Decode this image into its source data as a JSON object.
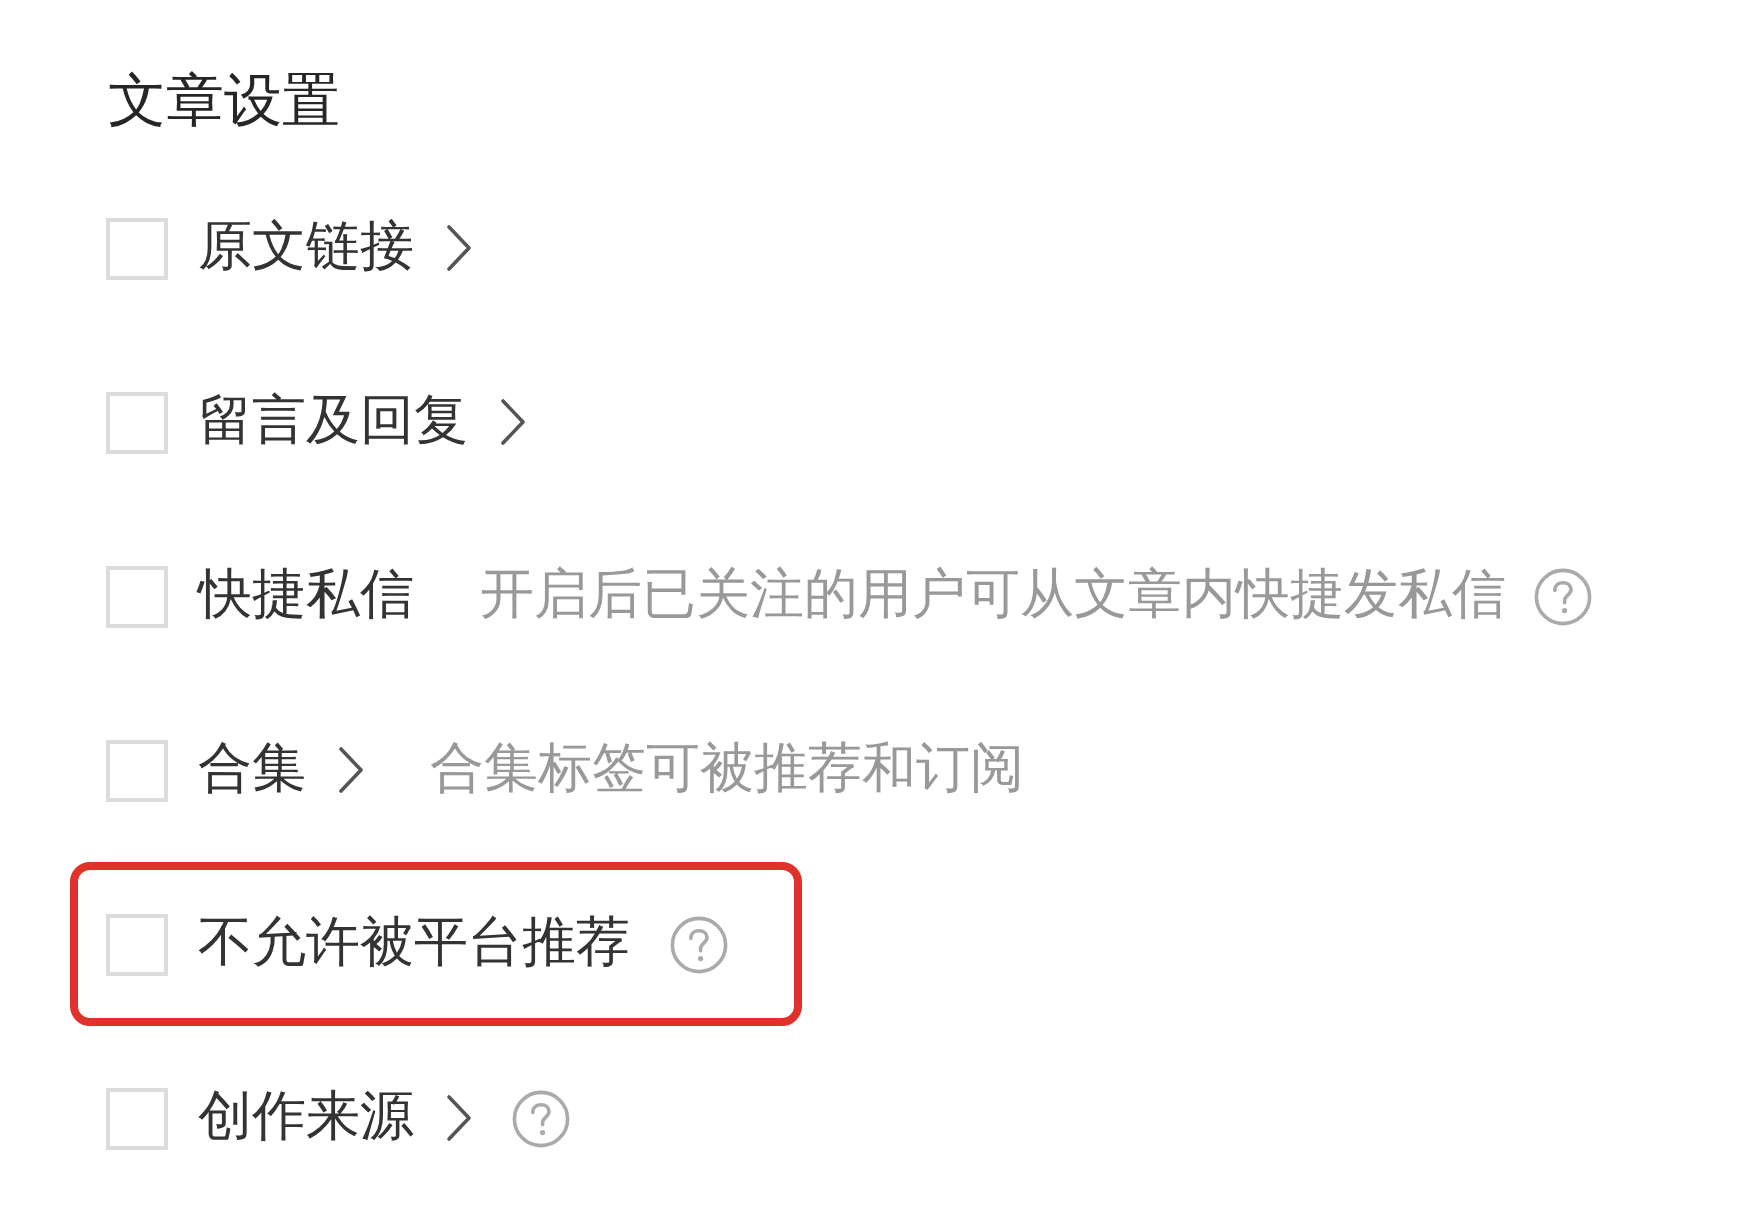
{
  "section": {
    "title": "文章设置"
  },
  "options": [
    {
      "label": "原文链接",
      "checked": false,
      "arrow": true,
      "help": false,
      "highlighted": false
    },
    {
      "label": "留言及回复",
      "checked": false,
      "arrow": true,
      "help": false,
      "highlighted": false
    },
    {
      "label": "快捷私信",
      "checked": false,
      "arrow": false,
      "hint": "开启后已关注的用户可从文章内快捷发私信",
      "help": true,
      "highlighted": false
    },
    {
      "label": "合集",
      "checked": false,
      "arrow": true,
      "hint": "合集标签可被推荐和订阅",
      "help": false,
      "highlighted": false
    },
    {
      "label": "不允许被平台推荐",
      "checked": false,
      "arrow": false,
      "help": true,
      "highlighted": true
    },
    {
      "label": "创作来源",
      "checked": false,
      "arrow": true,
      "help": true,
      "highlighted": false
    }
  ]
}
